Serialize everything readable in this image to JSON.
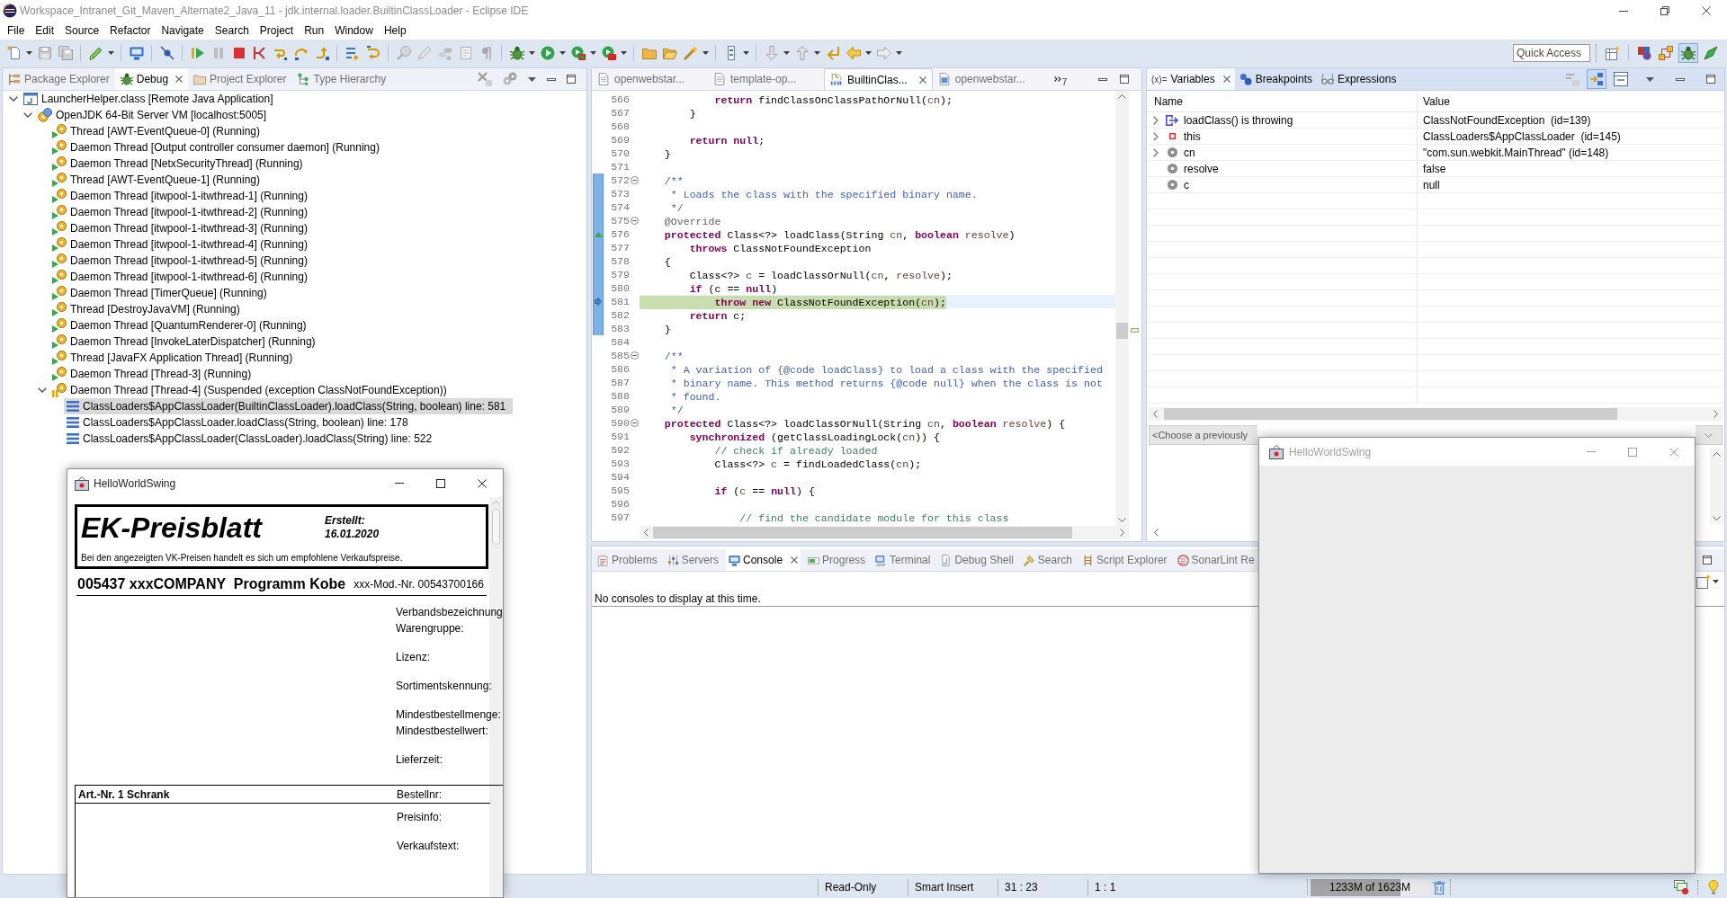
{
  "window": {
    "title": "Workspace_Intranet_Git_Maven_Alternate2_Java_11 - jdk.internal.loader.BuiltinClassLoader - Eclipse IDE"
  },
  "menu": [
    "File",
    "Edit",
    "Source",
    "Refactor",
    "Navigate",
    "Search",
    "Project",
    "Run",
    "Window",
    "Help"
  ],
  "quick_access": {
    "placeholder": "Quick Access"
  },
  "debug_view": {
    "tabs": [
      {
        "label": "Package Explorer",
        "selected": false
      },
      {
        "label": "Debug",
        "selected": true
      },
      {
        "label": "Project Explorer",
        "selected": false
      },
      {
        "label": "Type Hierarchy",
        "selected": false
      }
    ],
    "tree": [
      {
        "label": "LauncherHelper.class [Remote Java Application]",
        "kind": "launch",
        "expanded": true,
        "selected": false,
        "children": [
          {
            "label": "OpenJDK 64-Bit Server VM [localhost:5005]",
            "kind": "vm",
            "expanded": true,
            "selected": false,
            "children": [
              {
                "label": "Thread [AWT-EventQueue-0] (Running)",
                "kind": "thread",
                "suspended": false,
                "selected": false
              },
              {
                "label": "Daemon Thread [Output controller consumer daemon] (Running)",
                "kind": "thread",
                "suspended": false,
                "selected": false
              },
              {
                "label": "Daemon Thread [NetxSecurityThread] (Running)",
                "kind": "thread",
                "suspended": false,
                "selected": false
              },
              {
                "label": "Thread [AWT-EventQueue-1] (Running)",
                "kind": "thread",
                "suspended": false,
                "selected": false
              },
              {
                "label": "Daemon Thread [itwpool-1-itwthread-1] (Running)",
                "kind": "thread",
                "suspended": false,
                "selected": false
              },
              {
                "label": "Daemon Thread [itwpool-1-itwthread-2] (Running)",
                "kind": "thread",
                "suspended": false,
                "selected": false
              },
              {
                "label": "Daemon Thread [itwpool-1-itwthread-3] (Running)",
                "kind": "thread",
                "suspended": false,
                "selected": false
              },
              {
                "label": "Daemon Thread [itwpool-1-itwthread-4] (Running)",
                "kind": "thread",
                "suspended": false,
                "selected": false
              },
              {
                "label": "Daemon Thread [itwpool-1-itwthread-5] (Running)",
                "kind": "thread",
                "suspended": false,
                "selected": false
              },
              {
                "label": "Daemon Thread [itwpool-1-itwthread-6] (Running)",
                "kind": "thread",
                "suspended": false,
                "selected": false
              },
              {
                "label": "Daemon Thread [TimerQueue] (Running)",
                "kind": "thread",
                "suspended": false,
                "selected": false
              },
              {
                "label": "Thread [DestroyJavaVM] (Running)",
                "kind": "thread",
                "suspended": false,
                "selected": false
              },
              {
                "label": "Daemon Thread [QuantumRenderer-0] (Running)",
                "kind": "thread",
                "suspended": false,
                "selected": false
              },
              {
                "label": "Daemon Thread [InvokeLaterDispatcher] (Running)",
                "kind": "thread",
                "suspended": false,
                "selected": false
              },
              {
                "label": "Thread [JavaFX Application Thread] (Running)",
                "kind": "thread",
                "suspended": false,
                "selected": false
              },
              {
                "label": "Daemon Thread [Thread-3] (Running)",
                "kind": "thread",
                "suspended": false,
                "selected": false
              },
              {
                "label": "Daemon Thread [Thread-4] (Suspended (exception ClassNotFoundException))",
                "kind": "thread",
                "suspended": true,
                "expanded": true,
                "selected": false,
                "children": [
                  {
                    "label": "ClassLoaders$AppClassLoader(BuiltinClassLoader).loadClass(String, boolean) line: 581",
                    "kind": "frame",
                    "selected": true
                  },
                  {
                    "label": "ClassLoaders$AppClassLoader.loadClass(String, boolean) line: 178",
                    "kind": "frame",
                    "selected": false
                  },
                  {
                    "label": "ClassLoaders$AppClassLoader(ClassLoader).loadClass(String) line: 522",
                    "kind": "frame",
                    "selected": false
                  }
                ]
              }
            ]
          }
        ]
      }
    ]
  },
  "editor": {
    "tabs": [
      {
        "label": "openwebstar...",
        "kind": "text-file",
        "selected": false
      },
      {
        "label": "template-op...",
        "kind": "text-file",
        "selected": false
      },
      {
        "label": "BuiltinClas...",
        "kind": "class-file",
        "selected": true
      },
      {
        "label": "openwebstar...",
        "kind": "manifest",
        "selected": false
      }
    ],
    "tab_overflow_count": "7",
    "lines": [
      {
        "number": "566",
        "current": false,
        "tokens": [
          {
            "kind": "keyword",
            "text": "            return"
          },
          {
            "kind": "plain",
            "text": " findClassOnClassPathOrNull("
          },
          {
            "kind": "variable",
            "text": "cn"
          },
          {
            "kind": "plain",
            "text": ");"
          }
        ]
      },
      {
        "number": "567",
        "current": false,
        "tokens": [
          {
            "kind": "plain",
            "text": "        }"
          }
        ]
      },
      {
        "number": "568",
        "current": false
      },
      {
        "number": "569",
        "current": false,
        "tokens": [
          {
            "kind": "keyword",
            "text": "        return null"
          },
          {
            "kind": "plain",
            "text": ";"
          }
        ]
      },
      {
        "number": "570",
        "current": false,
        "tokens": [
          {
            "kind": "plain",
            "text": "    }"
          }
        ]
      },
      {
        "number": "571",
        "current": false
      },
      {
        "number": "572",
        "current": false,
        "in_range": true,
        "fold_expanded": true,
        "tokens": [
          {
            "kind": "javadoc",
            "text": "    /**"
          }
        ]
      },
      {
        "number": "573",
        "current": false,
        "in_range": true,
        "tokens": [
          {
            "kind": "javadoc",
            "text": "     * Loads the class with the specified binary name."
          }
        ]
      },
      {
        "number": "574",
        "current": false,
        "in_range": true,
        "tokens": [
          {
            "kind": "javadoc",
            "text": "     */"
          }
        ]
      },
      {
        "number": "575",
        "current": false,
        "in_range": true,
        "fold_expanded": true,
        "tokens": [
          {
            "kind": "annotation",
            "text": "    @Override"
          }
        ]
      },
      {
        "number": "576",
        "current": false,
        "in_range": true,
        "override_marker": true,
        "tokens": [
          {
            "kind": "keyword",
            "text": "    protected"
          },
          {
            "kind": "plain",
            "text": " Class<?> loadClass(String "
          },
          {
            "kind": "variable",
            "text": "cn"
          },
          {
            "kind": "plain",
            "text": ", "
          },
          {
            "kind": "keyword",
            "text": "boolean"
          },
          {
            "kind": "variable",
            "text": " resolve"
          },
          {
            "kind": "plain",
            "text": ")"
          }
        ]
      },
      {
        "number": "577",
        "current": false,
        "in_range": true,
        "tokens": [
          {
            "kind": "keyword",
            "text": "        throws"
          },
          {
            "kind": "plain",
            "text": " ClassNotFoundException"
          }
        ]
      },
      {
        "number": "578",
        "current": false,
        "in_range": true,
        "tokens": [
          {
            "kind": "plain",
            "text": "    {"
          }
        ]
      },
      {
        "number": "579",
        "current": false,
        "in_range": true,
        "tokens": [
          {
            "kind": "plain",
            "text": "        Class<?> "
          },
          {
            "kind": "variable",
            "text": "c"
          },
          {
            "kind": "plain",
            "text": " = loadClassOrNull("
          },
          {
            "kind": "variable",
            "text": "cn"
          },
          {
            "kind": "plain",
            "text": ", "
          },
          {
            "kind": "variable",
            "text": "resolve"
          },
          {
            "kind": "plain",
            "text": ");"
          }
        ]
      },
      {
        "number": "580",
        "current": false,
        "in_range": true,
        "tokens": [
          {
            "kind": "keyword",
            "text": "        if"
          },
          {
            "kind": "plain",
            "text": " (c == "
          },
          {
            "kind": "keyword",
            "text": "null"
          },
          {
            "kind": "plain",
            "text": ")"
          }
        ]
      },
      {
        "number": "581",
        "current": true,
        "in_range": true,
        "tokens": [
          {
            "kind": "keyword",
            "text": "            throw new"
          },
          {
            "kind": "plain",
            "text": " ClassNotFoundException("
          },
          {
            "kind": "variable",
            "text": "cn"
          },
          {
            "kind": "plain",
            "text": ");"
          }
        ]
      },
      {
        "number": "582",
        "current": false,
        "in_range": true,
        "tokens": [
          {
            "kind": "keyword",
            "text": "        return"
          },
          {
            "kind": "plain",
            "text": " c;"
          }
        ]
      },
      {
        "number": "583",
        "current": false,
        "in_range": true,
        "tokens": [
          {
            "kind": "plain",
            "text": "    }"
          }
        ]
      },
      {
        "number": "584",
        "current": false
      },
      {
        "number": "585",
        "current": false,
        "fold_expanded": true,
        "tokens": [
          {
            "kind": "javadoc",
            "text": "    /**"
          }
        ]
      },
      {
        "number": "586",
        "current": false,
        "tokens": [
          {
            "kind": "javadoc",
            "text": "     * A variation of {@code loadClass} to load a class with the specified"
          }
        ]
      },
      {
        "number": "587",
        "current": false,
        "tokens": [
          {
            "kind": "javadoc",
            "text": "     * binary name. This method returns {@code null} when the class is not"
          }
        ]
      },
      {
        "number": "588",
        "current": false,
        "tokens": [
          {
            "kind": "javadoc",
            "text": "     * found."
          }
        ]
      },
      {
        "number": "589",
        "current": false,
        "tokens": [
          {
            "kind": "javadoc",
            "text": "     */"
          }
        ]
      },
      {
        "number": "590",
        "current": false,
        "fold_expanded": true,
        "tokens": [
          {
            "kind": "keyword",
            "text": "    protected"
          },
          {
            "kind": "plain",
            "text": " Class<?> loadClassOrNull(String "
          },
          {
            "kind": "variable",
            "text": "cn"
          },
          {
            "kind": "plain",
            "text": ", "
          },
          {
            "kind": "keyword",
            "text": "boolean"
          },
          {
            "kind": "variable",
            "text": " resolve"
          },
          {
            "kind": "plain",
            "text": ") {"
          }
        ]
      },
      {
        "number": "591",
        "current": false,
        "tokens": [
          {
            "kind": "keyword",
            "text": "        synchronized"
          },
          {
            "kind": "plain",
            "text": " (getClassLoadingLock("
          },
          {
            "kind": "variable",
            "text": "cn"
          },
          {
            "kind": "plain",
            "text": ")) {"
          }
        ]
      },
      {
        "number": "592",
        "current": false,
        "tokens": [
          {
            "kind": "comment",
            "text": "            // check if already loaded"
          }
        ]
      },
      {
        "number": "593",
        "current": false,
        "tokens": [
          {
            "kind": "plain",
            "text": "            Class<?> "
          },
          {
            "kind": "variable",
            "text": "c"
          },
          {
            "kind": "plain",
            "text": " = findLoadedClass("
          },
          {
            "kind": "variable",
            "text": "cn"
          },
          {
            "kind": "plain",
            "text": ");"
          }
        ]
      },
      {
        "number": "594",
        "current": false
      },
      {
        "number": "595",
        "current": false,
        "tokens": [
          {
            "kind": "keyword",
            "text": "            if"
          },
          {
            "kind": "plain",
            "text": " ("
          },
          {
            "kind": "variable",
            "text": "c"
          },
          {
            "kind": "plain",
            "text": " == "
          },
          {
            "kind": "keyword",
            "text": "null"
          },
          {
            "kind": "plain",
            "text": ") {"
          }
        ]
      },
      {
        "number": "596",
        "current": false
      },
      {
        "number": "597",
        "current": false,
        "tokens": [
          {
            "kind": "comment",
            "text": "                // find the candidate module for this class"
          }
        ]
      }
    ]
  },
  "variables_view": {
    "tabs": [
      {
        "label": "Variables",
        "glyph": "(x)=",
        "selected": true
      },
      {
        "label": "Breakpoints",
        "selected": false
      },
      {
        "label": "Expressions",
        "selected": false
      }
    ],
    "columns": [
      "Name",
      "Value"
    ],
    "rows": [
      {
        "name": "loadClass() is throwing",
        "value": "ClassNotFoundException  (id=139)",
        "kind": "exception",
        "expanded": false,
        "selected": false
      },
      {
        "name": "this",
        "value": "ClassLoaders$AppClassLoader  (id=145)",
        "kind": "field",
        "expanded": false,
        "selected": false
      },
      {
        "name": "cn",
        "value": "\"com.sun.webkit.MainThread\" (id=148)",
        "kind": "local",
        "expanded": false,
        "selected": false
      },
      {
        "name": "resolve",
        "value": "false",
        "kind": "local",
        "selected": false
      },
      {
        "name": "c",
        "value": "null",
        "kind": "local",
        "selected": false
      }
    ],
    "detail_selector": {
      "value": "<Choose a previously"
    }
  },
  "console_view": {
    "tabs": [
      {
        "label": "Problems",
        "selected": false
      },
      {
        "label": "Servers",
        "selected": false
      },
      {
        "label": "Console",
        "selected": true
      },
      {
        "label": "Progress",
        "selected": false
      },
      {
        "label": "Terminal",
        "selected": false
      },
      {
        "label": "Debug Shell",
        "selected": false
      },
      {
        "label": "Search",
        "selected": false
      },
      {
        "label": "Script Explorer",
        "selected": false
      },
      {
        "label": "SonarLint Re",
        "selected": false
      }
    ],
    "message": "No consoles to display at this time."
  },
  "status_bar": {
    "fields": [
      "Read-Only",
      "Smart Insert",
      "31 : 23",
      "1 : 1"
    ],
    "heap": {
      "text": "1233M of 1623M",
      "level": 0.76
    }
  },
  "app_windows": [
    {
      "title": "HelloWorldSwing",
      "active": true,
      "document": {
        "title": "EK-Preisblatt",
        "created_label": "Erstellt:",
        "created_date": "16.01.2020",
        "note": "Bei den angezeigten VK-Preisen handelt es sich um empfohlene Verkaufspreise.",
        "product": "005437 xxxCOMPANY  Programm Kobe",
        "model_number": "xxx-Mod.-Nr. 00543700166",
        "field_groups": [
          [
            "Verbandsbezeichnung",
            "Warengruppe:"
          ],
          [
            "Lizenz:"
          ],
          [
            "Sortimentskennung:"
          ],
          [
            "Mindestbestellmenge:",
            "Mindestbestellwert:"
          ],
          [
            "Lieferzeit:"
          ]
        ],
        "article": {
          "title": "Art.-Nr. 1 Schrank",
          "order_label": "Bestellnr:",
          "fields": [
            "Preisinfo:",
            "Verkaufstext:"
          ]
        }
      }
    },
    {
      "title": "HelloWorldSwing",
      "active": false
    }
  ]
}
